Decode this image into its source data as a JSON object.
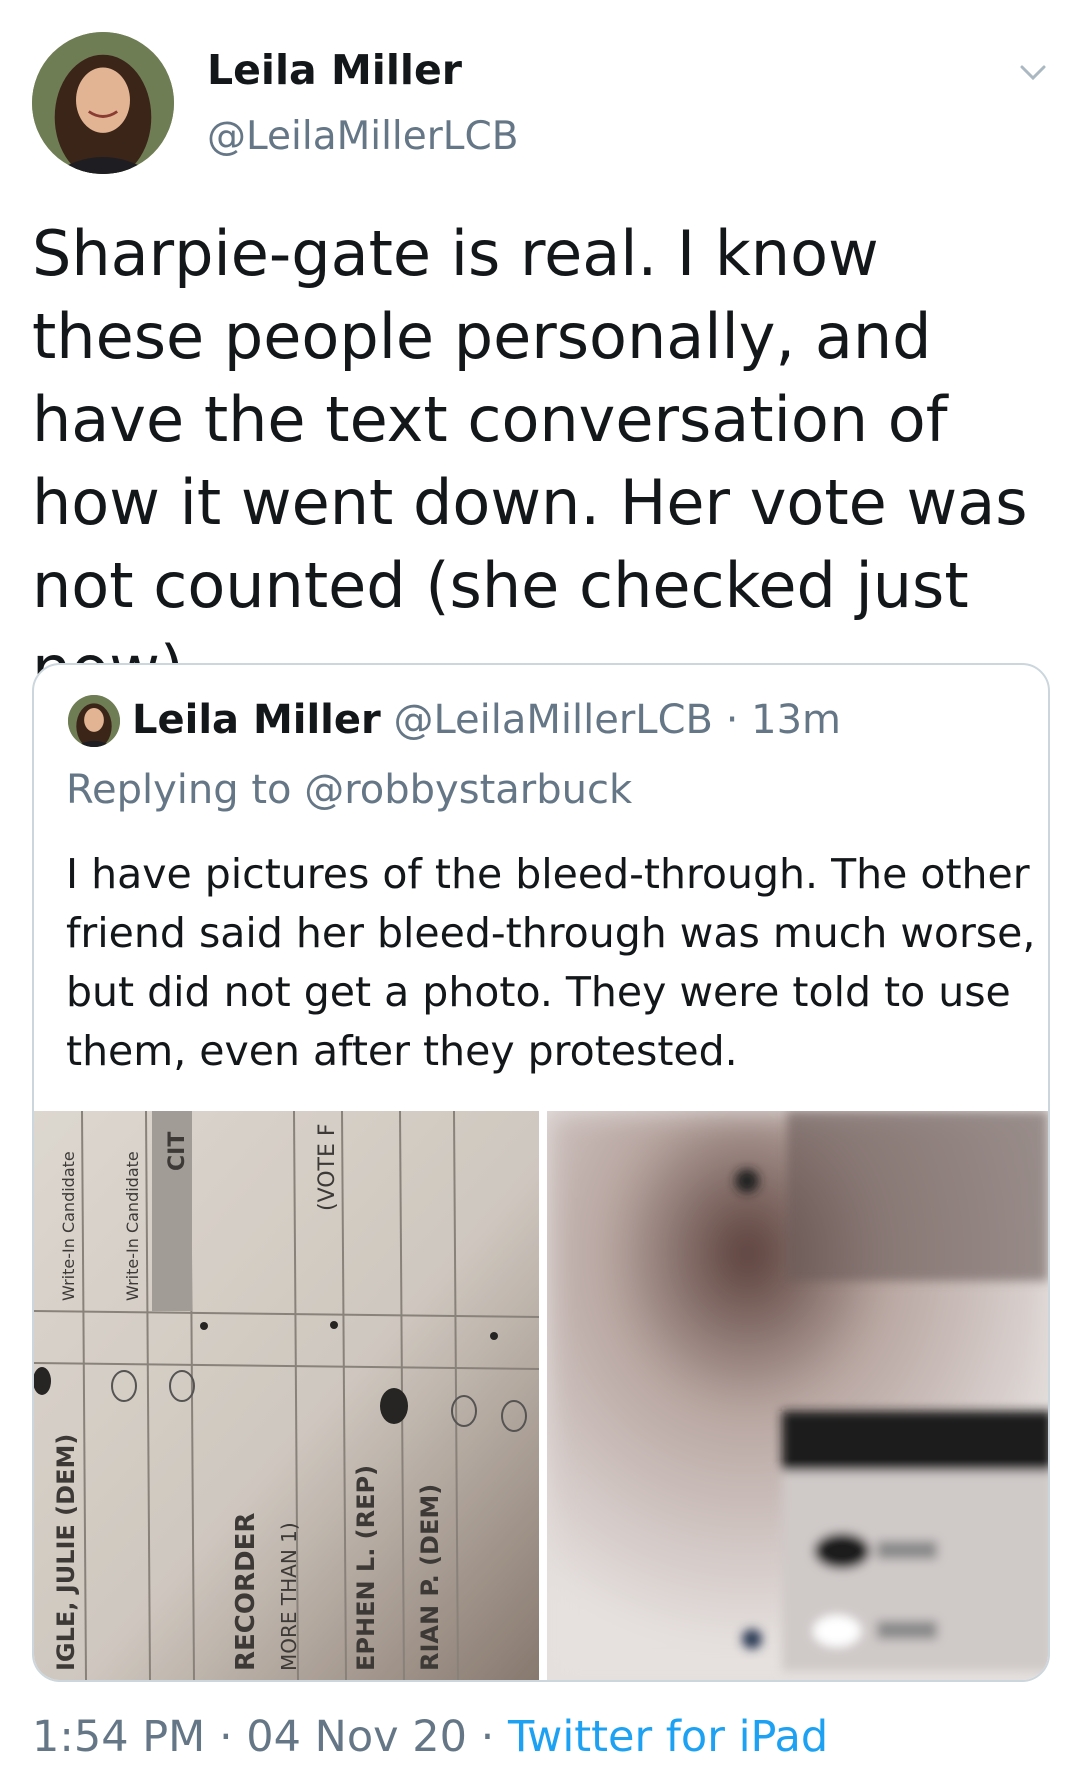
{
  "tweet": {
    "author_name": "Leila Miller",
    "author_handle": "@LeilaMillerLCB",
    "text": "Sharpie-gate is real. I know these people personally, and have the text conversation of how it went down. Her vote was not counted (she checked just now).",
    "time": "1:54 PM",
    "date": "04 Nov 20",
    "source": "Twitter for iPad",
    "separator": "·"
  },
  "quoted_tweet": {
    "author_name": "Leila Miller",
    "author_handle": "@LeilaMillerLCB",
    "age": "13m",
    "replying_prefix": "Replying to",
    "replying_to": "@robbystarbuck",
    "text": "I have pictures of the bleed-through. The other friend said her bleed-through was much worse, but did not get a photo. They were told to use them, even after they protested.",
    "photos": {
      "left_labels": [
        "Write-In Candidate",
        "Write-In Candidate",
        "CIT",
        "(VOTE F",
        "IGLE, JULIE (DEM)",
        "RECORDER",
        "MORE THAN 1)",
        "EPHEN L. (REP)",
        "RIAN P. (DEM)"
      ]
    }
  },
  "icons": {
    "chevron": "chevron-down-icon",
    "avatar": "avatar"
  },
  "colors": {
    "text": "#14171a",
    "secondary": "#657786",
    "link": "#1da1f2",
    "border": "#ccd6dd"
  }
}
